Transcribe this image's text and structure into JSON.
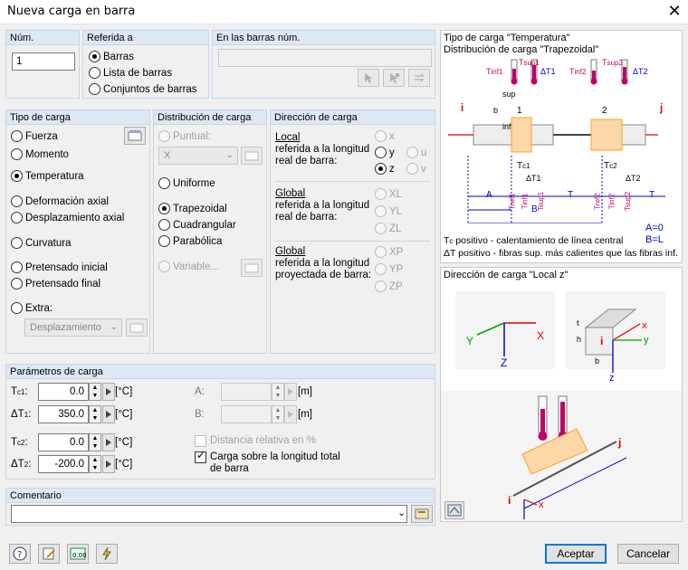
{
  "window": {
    "title": "Nueva carga en barra",
    "close": "✕"
  },
  "num": {
    "label": "Núm.",
    "value": "1"
  },
  "referida": {
    "label": "Referida a",
    "options": [
      "Barras",
      "Lista de barras",
      "Conjuntos de barras"
    ],
    "selected": 0
  },
  "barras": {
    "label": "En las barras núm.",
    "value": ""
  },
  "tipo": {
    "label": "Tipo de carga",
    "options": [
      "Fuerza",
      "Momento",
      "Temperatura",
      "Deformación axial",
      "Desplazamiento axial",
      "Curvatura",
      "Pretensado inicial",
      "Pretensado final",
      "Extra:"
    ],
    "selected": 2,
    "extra_select": "Desplazamiento"
  },
  "distribucion": {
    "label": "Distribución de carga",
    "puntual": "Puntual:",
    "puntual_select": "X",
    "options": [
      "Uniforme",
      "Trapezoidal",
      "Cuadrangular",
      "Parabólica",
      "Variable..."
    ],
    "selected": 1
  },
  "direccion": {
    "label": "Dirección de carga",
    "local_text": [
      "Local",
      "referida a la longitud",
      "real de barra:"
    ],
    "global_text": [
      "Global",
      "referida a la longitud",
      "real de barra:"
    ],
    "global_proj_text": [
      "Global",
      "referida a la longitud",
      "proyectada de barra:"
    ],
    "local_opts": [
      "x",
      "y",
      "z",
      "u",
      "v"
    ],
    "global_opts": [
      "XL",
      "YL",
      "ZL"
    ],
    "proj_opts": [
      "XP",
      "YP",
      "ZP"
    ],
    "selected": "z"
  },
  "params": {
    "label": "Parámetros de carga",
    "rows": [
      {
        "name": "T",
        "sub": "c1",
        "suffix": ":",
        "value": "0.0",
        "unit": "[°C]"
      },
      {
        "name": "ΔT",
        "sub": "1",
        "suffix": ":",
        "value": "350.0",
        "unit": "[°C]"
      },
      {
        "name": "T",
        "sub": "c2",
        "suffix": ":",
        "value": "0.0",
        "unit": "[°C]"
      },
      {
        "name": "ΔT",
        "sub": "2",
        "suffix": ":",
        "value": "-200.0",
        "unit": "[°C]"
      }
    ],
    "a_label": "A:",
    "b_label": "B:",
    "a_unit": "[m]",
    "b_unit": "[m]",
    "dist_rel": "Distancia relativa en %",
    "carga_total": "Carga sobre la longitud total de barra"
  },
  "comentario": {
    "label": "Comentario",
    "value": ""
  },
  "diagram1": {
    "title1": "Tipo de carga \"Temperatura\"",
    "title2": "Distribución de carga \"Trapezoidal\"",
    "note_tc": "T",
    "note_tc_sub": "c",
    "note_tc_rest": " positivo - calentamiento de línea central",
    "note_dt": "ΔT positivo - fibras sup. más calientes que las fibras inf.",
    "a0": "A=0",
    "bl": "B=L",
    "sup": "sup",
    "inf": "inf",
    "tinf1": "T",
    "tinf1_sub": "inf1",
    "tsup1": "T",
    "tsup1_sub": "sup1",
    "tinf2": "T",
    "tinf2_sub": "inf2",
    "tsup2": "T",
    "tsup2_sub": "sup2",
    "dt1": "ΔT1",
    "dt2": "ΔT2",
    "tc1": "T",
    "tc1_sub": "c1",
    "tc2": "T",
    "tc2_sub": "c2",
    "dt1b": "ΔT1",
    "dt2b": "ΔT2",
    "tref1": "Tref1",
    "tinf1b": "Tinf1",
    "tsup1b": "Tsup1",
    "tref2": "Tref2",
    "tinf2b": "Tinf2",
    "tsup2b": "Tsup2",
    "i": "i",
    "j": "j",
    "b": "b",
    "n1": "1",
    "n2": "2",
    "A": "A",
    "B": "B",
    "T": "T"
  },
  "diagram2": {
    "title": "Dirección de carga \"Local z\"",
    "X": "X",
    "Y": "Y",
    "Z": "Z",
    "x": "x",
    "y": "y",
    "z": "z",
    "t": "t",
    "h": "h",
    "b": "b",
    "i": "i",
    "j": "j"
  },
  "buttons": {
    "accept": "Aceptar",
    "cancel": "Cancelar"
  },
  "colors": {
    "accent": "#0078d7",
    "header": "#dde8f5",
    "orange": "#f5a623",
    "magenta": "#c0006a",
    "diag_blue": "#0000cc",
    "red": "#e00000"
  }
}
